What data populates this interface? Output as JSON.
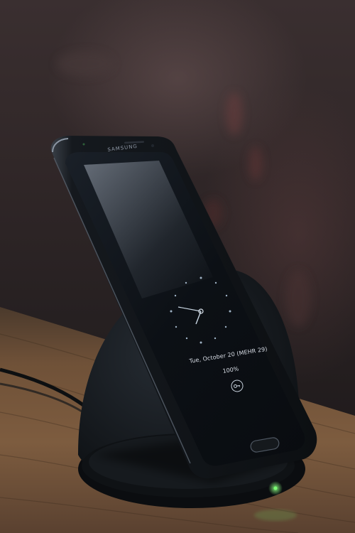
{
  "photo": {
    "subject": "Smartphone standing on a wireless charging stand on a wooden table",
    "phone": {
      "brand_label": "SAMSUNG",
      "lockscreen": {
        "date_line": "Tue, October 20 (MEHR 29)",
        "battery_line": "100%",
        "unlock_icon": "key-icon"
      }
    },
    "charger": {
      "led_color": "#6dff6a"
    },
    "colors": {
      "wall": "#2f2627",
      "table": "#7a5a3d",
      "phone_body": "#111418",
      "screen": "#0d1116",
      "charger": "#14181c"
    }
  }
}
